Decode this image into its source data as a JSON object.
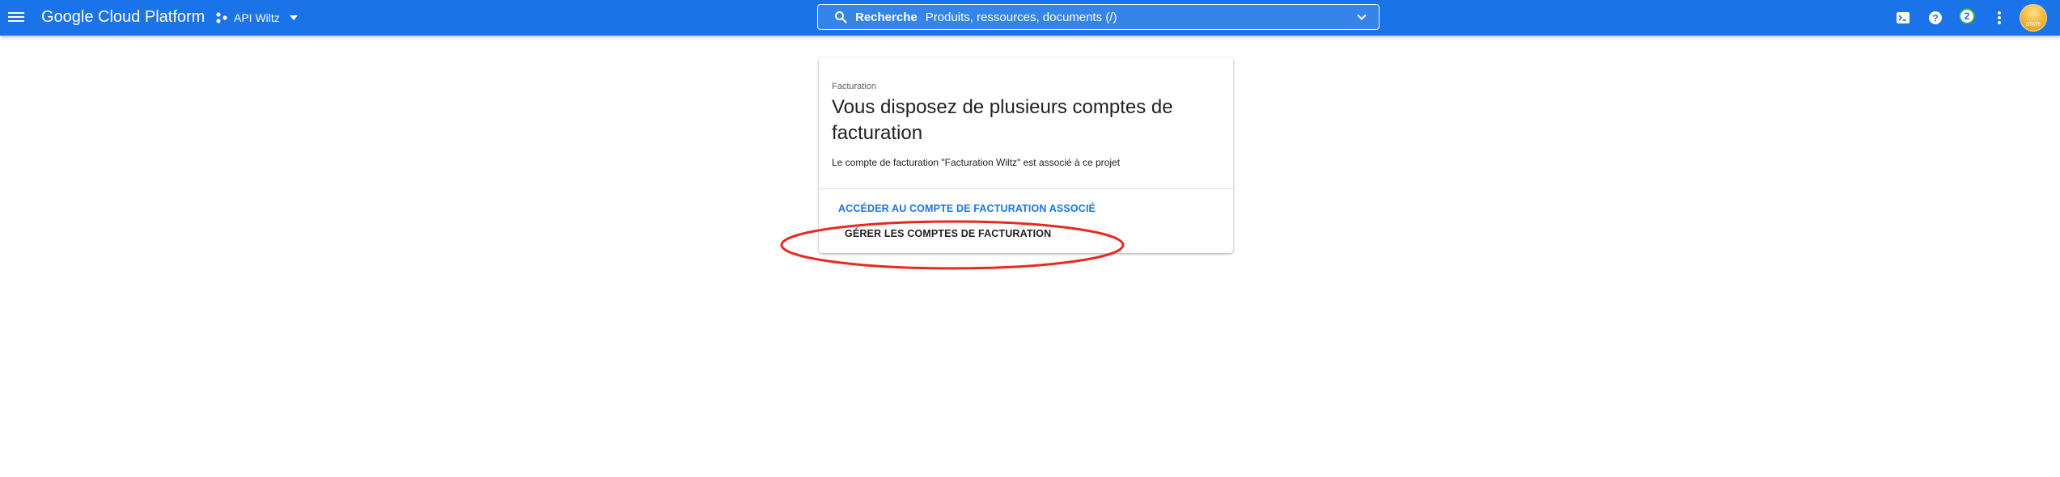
{
  "header": {
    "brand": "Google Cloud Platform",
    "project": "API Wiltz",
    "search": {
      "label": "Recherche",
      "placeholder": "Produits, ressources, documents (/)"
    },
    "notifications_count": "2",
    "avatar_text": "STATS"
  },
  "card": {
    "eyebrow": "Facturation",
    "title": "Vous disposez de plusieurs comptes de facturation",
    "description": "Le compte de facturation \"Facturation Wiltz\" est associé à ce projet",
    "link_label": "ACCÉDER AU COMPTE DE FACTURATION ASSOCIÉ",
    "manage_label": "GÉRER LES COMPTES DE FACTURATION"
  },
  "colors": {
    "header_bg": "#1a73e8",
    "link": "#1a73e8",
    "annotation": "#e8291b"
  },
  "icons": {
    "menu": "menu-icon",
    "project": "project-icon",
    "search": "search-icon",
    "search_dropdown": "chevron-down-icon",
    "cloud_shell": "cloud-shell-icon",
    "help": "help-icon",
    "more": "more-vert-icon"
  }
}
